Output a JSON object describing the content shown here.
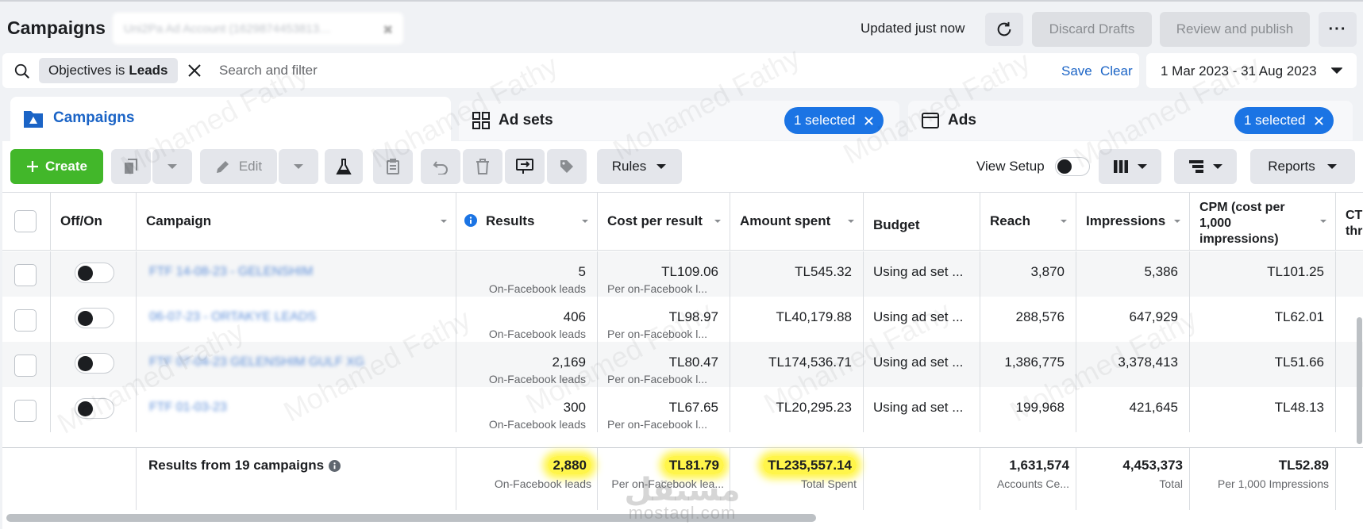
{
  "header": {
    "title": "Campaigns",
    "account": "Uni2Pa Ad Account (1629874453813…",
    "updated": "Updated just now",
    "discard_label": "Discard Drafts",
    "review_label": "Review and publish",
    "more_label": "···"
  },
  "search": {
    "chip_prefix": "Objectives is",
    "chip_value": "Leads",
    "placeholder": "Search and filter",
    "save_label": "Save",
    "clear_label": "Clear",
    "date_range": "1 Mar 2023 - 31 Aug 2023"
  },
  "tabs": {
    "campaigns": "Campaigns",
    "adsets": "Ad sets",
    "adsets_selected": "1 selected",
    "ads": "Ads",
    "ads_selected": "1 selected"
  },
  "toolbar": {
    "create_label": "Create",
    "edit_label": "Edit",
    "rules_label": "Rules",
    "view_setup_label": "View Setup",
    "reports_label": "Reports"
  },
  "columns": {
    "offon": "Off/On",
    "campaign": "Campaign",
    "results": "Results",
    "cost": "Cost per result",
    "amount": "Amount spent",
    "budget": "Budget",
    "reach": "Reach",
    "impressions": "Impressions",
    "cpm_1": "CPM (cost per",
    "cpm_2": "1,000",
    "cpm_3": "impressions)",
    "ctr_1": "CT",
    "ctr_2": "thr"
  },
  "rows": [
    {
      "name": "FTF 14-08-23 - GELENSHIM",
      "results": "5",
      "results_sub": "On-Facebook leads",
      "cost": "TL109.06",
      "cost_sub": "Per on-Facebook l...",
      "amount": "TL545.32",
      "budget": "Using ad set ...",
      "reach": "3,870",
      "impressions": "5,386",
      "cpm": "TL101.25"
    },
    {
      "name": "06-07-23 - ORTAKYE LEADS",
      "results": "406",
      "results_sub": "On-Facebook leads",
      "cost": "TL98.97",
      "cost_sub": "Per on-Facebook l...",
      "amount": "TL40,179.88",
      "budget": "Using ad set ...",
      "reach": "288,576",
      "impressions": "647,929",
      "cpm": "TL62.01"
    },
    {
      "name": "FTF 07-04-23 GELENSHIM GULF XG",
      "results": "2,169",
      "results_sub": "On-Facebook leads",
      "cost": "TL80.47",
      "cost_sub": "Per on-Facebook l...",
      "amount": "TL174,536.71",
      "budget": "Using ad set ...",
      "reach": "1,386,775",
      "impressions": "3,378,413",
      "cpm": "TL51.66"
    },
    {
      "name": "FTF 01-03-23",
      "results": "300",
      "results_sub": "On-Facebook leads",
      "cost": "TL67.65",
      "cost_sub": "Per on-Facebook l...",
      "amount": "TL20,295.23",
      "budget": "Using ad set ...",
      "reach": "199,968",
      "impressions": "421,645",
      "cpm": "TL48.13"
    }
  ],
  "totals": {
    "label": "Results from 19 campaigns",
    "results": "2,880",
    "results_sub": "On-Facebook leads",
    "cost": "TL81.79",
    "cost_sub": "Per on-Facebook lea...",
    "amount": "TL235,557.14",
    "amount_sub": "Total Spent",
    "reach": "1,631,574",
    "reach_sub": "Accounts Ce...",
    "impressions": "4,453,373",
    "impressions_sub": "Total",
    "cpm": "TL52.89",
    "cpm_sub": "Per 1,000 Impressions"
  },
  "watermark": {
    "text": "Mohamed Fathy",
    "logo_ar": "مستقل",
    "logo_en": "mostaql.com"
  },
  "colors": {
    "accent": "#1b74e4",
    "create": "#42b72a",
    "highlight": "#fff54a"
  }
}
